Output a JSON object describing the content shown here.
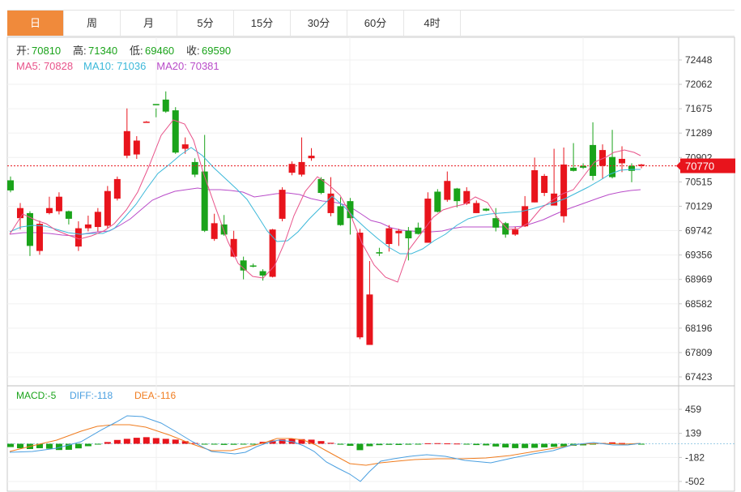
{
  "tabs": [
    {
      "label": "日",
      "active": true
    },
    {
      "label": "周",
      "active": false
    },
    {
      "label": "月",
      "active": false
    },
    {
      "label": "5分",
      "active": false
    },
    {
      "label": "15分",
      "active": false
    },
    {
      "label": "30分",
      "active": false
    },
    {
      "label": "60分",
      "active": false
    },
    {
      "label": "4时",
      "active": false
    }
  ],
  "ohlc_info": [
    {
      "label": "开:",
      "value": "70810"
    },
    {
      "label": "高:",
      "value": "71340"
    },
    {
      "label": "低:",
      "value": "69460"
    },
    {
      "label": "收:",
      "value": "69590"
    }
  ],
  "ma_info": [
    {
      "label": "MA5:",
      "value": "70828",
      "color": "#e8538a"
    },
    {
      "label": "MA10:",
      "value": "71036",
      "color": "#3bb8d9"
    },
    {
      "label": "MA20:",
      "value": "70381",
      "color": "#b94cc9"
    }
  ],
  "macd_info": [
    {
      "label": "MACD:",
      "value": "-5",
      "color": "#1aa31a"
    },
    {
      "label": "DIFF:",
      "value": "-118",
      "color": "#4a9fe0"
    },
    {
      "label": "DEA:",
      "value": "-116",
      "color": "#f07c1f"
    }
  ],
  "colors": {
    "up": "#e8141c",
    "down": "#1aa31a",
    "text": "#333333",
    "grid": "#f0f0f0",
    "axis": "#c8c8c8",
    "price_tag": "#e8141c"
  },
  "current_price": {
    "value": 70770,
    "label": "70770"
  },
  "chart_data": {
    "type": "candlestick",
    "price_axis": {
      "ticks": [
        72448,
        72062,
        71675,
        71289,
        70902,
        70515,
        70129,
        69742,
        69356,
        68969,
        68582,
        68196,
        67809,
        67423
      ]
    },
    "macd_axis": {
      "ticks": [
        459,
        139,
        -182,
        -502
      ]
    },
    "candles": [
      [
        70540,
        70380,
        70600,
        70350
      ],
      [
        69940,
        70100,
        70180,
        69760
      ],
      [
        70020,
        69500,
        70050,
        69340
      ],
      [
        69420,
        69850,
        69900,
        69360
      ],
      [
        70020,
        70100,
        70280,
        70000
      ],
      [
        70050,
        70280,
        70350,
        70000
      ],
      [
        70050,
        69930,
        70060,
        69840
      ],
      [
        69490,
        69780,
        69890,
        69420
      ],
      [
        69780,
        69840,
        69980,
        69730
      ],
      [
        69800,
        70040,
        70100,
        69730
      ],
      [
        69820,
        70370,
        70450,
        69780
      ],
      [
        70250,
        70560,
        70600,
        70220
      ],
      [
        70930,
        71320,
        71680,
        70890
      ],
      [
        70950,
        71170,
        71240,
        70880
      ],
      [
        71470,
        71470,
        71480,
        71470
      ],
      [
        71750,
        71730,
        71680,
        71540
      ],
      [
        71820,
        71630,
        71950,
        71610
      ],
      [
        71650,
        70980,
        71700,
        70960
      ],
      [
        71040,
        71110,
        71220,
        70960
      ],
      [
        70830,
        70630,
        70890,
        70590
      ],
      [
        70680,
        69740,
        71260,
        69720
      ],
      [
        69610,
        69860,
        70010,
        69580
      ],
      [
        69840,
        69680,
        69990,
        69660
      ],
      [
        69330,
        69610,
        69740,
        69320
      ],
      [
        69270,
        69110,
        69330,
        68970
      ],
      [
        69190,
        69180,
        69220,
        69160
      ],
      [
        69100,
        69030,
        69130,
        68950
      ],
      [
        69010,
        69760,
        69770,
        69000
      ],
      [
        69930,
        70390,
        70430,
        69890
      ],
      [
        70660,
        70800,
        70840,
        70620
      ],
      [
        70630,
        70830,
        71220,
        70600
      ],
      [
        70890,
        70930,
        71050,
        70850
      ],
      [
        70560,
        70340,
        70590,
        70320
      ],
      [
        70020,
        70330,
        70590,
        69970
      ],
      [
        70130,
        69830,
        70270,
        69820
      ],
      [
        70210,
        69940,
        70260,
        69680
      ],
      [
        68050,
        69710,
        69770,
        68020
      ],
      [
        67930,
        68730,
        69260,
        67940
      ],
      [
        69400,
        69380,
        69470,
        69340
      ],
      [
        69530,
        69780,
        69830,
        69410
      ],
      [
        69700,
        69740,
        69770,
        69500
      ],
      [
        69740,
        69620,
        69800,
        69270
      ],
      [
        69790,
        69690,
        69870,
        69680
      ],
      [
        69550,
        70250,
        70350,
        69550
      ],
      [
        70360,
        70040,
        70400,
        70030
      ],
      [
        70230,
        70530,
        70680,
        70200
      ],
      [
        70410,
        70210,
        70420,
        70110
      ],
      [
        70170,
        70370,
        70430,
        70150
      ],
      [
        70020,
        70180,
        70220,
        70020
      ],
      [
        70090,
        70060,
        70100,
        70050
      ],
      [
        69940,
        69790,
        70100,
        69730
      ],
      [
        69860,
        69680,
        69880,
        69630
      ],
      [
        69680,
        69760,
        69800,
        69660
      ],
      [
        69810,
        70130,
        70290,
        69800
      ],
      [
        70190,
        70700,
        70900,
        70190
      ],
      [
        70340,
        70610,
        70640,
        70290
      ],
      [
        70140,
        70330,
        71040,
        70150
      ],
      [
        69970,
        70790,
        71060,
        69870
      ],
      [
        70740,
        70690,
        71130,
        70680
      ],
      [
        70770,
        70740,
        70810,
        70720
      ],
      [
        71100,
        70610,
        71460,
        70540
      ],
      [
        70770,
        71020,
        71110,
        70560
      ],
      [
        70910,
        70590,
        71340,
        70570
      ],
      [
        70810,
        70880,
        71080,
        70670
      ],
      [
        70770,
        70690,
        70810,
        70510
      ],
      [
        70770,
        70790,
        70800,
        70730
      ]
    ],
    "ma5": [
      [
        12,
        289
      ],
      [
        28,
        264
      ],
      [
        45,
        272
      ],
      [
        57,
        276
      ],
      [
        69,
        284
      ],
      [
        84,
        290
      ],
      [
        98,
        295
      ],
      [
        113,
        291
      ],
      [
        128,
        285
      ],
      [
        141,
        276
      ],
      [
        156,
        259
      ],
      [
        170,
        237
      ],
      [
        184,
        205
      ],
      [
        199,
        167
      ],
      [
        214,
        148
      ],
      [
        228,
        153
      ],
      [
        239,
        173
      ],
      [
        251,
        213
      ],
      [
        265,
        253
      ],
      [
        281,
        297
      ],
      [
        294,
        325
      ],
      [
        312,
        341
      ],
      [
        325,
        343
      ],
      [
        339,
        328
      ],
      [
        352,
        298
      ],
      [
        363,
        266
      ],
      [
        377,
        236
      ],
      [
        392,
        218
      ],
      [
        407,
        229
      ],
      [
        420,
        241
      ],
      [
        432,
        263
      ],
      [
        447,
        300
      ],
      [
        462,
        327
      ],
      [
        476,
        342
      ],
      [
        491,
        348
      ],
      [
        505,
        308
      ],
      [
        520,
        288
      ],
      [
        535,
        268
      ],
      [
        547,
        259
      ],
      [
        560,
        255
      ],
      [
        573,
        252
      ],
      [
        587,
        243
      ],
      [
        602,
        250
      ],
      [
        615,
        270
      ],
      [
        627,
        283
      ],
      [
        640,
        282
      ],
      [
        653,
        275
      ],
      [
        668,
        257
      ],
      [
        682,
        247
      ],
      [
        695,
        239
      ],
      [
        708,
        234
      ],
      [
        721,
        217
      ],
      [
        734,
        200
      ],
      [
        748,
        194
      ],
      [
        758,
        188
      ],
      [
        771,
        185
      ],
      [
        783,
        188
      ],
      [
        791,
        192
      ]
    ],
    "ma10": [
      [
        12,
        286
      ],
      [
        26,
        280
      ],
      [
        41,
        278
      ],
      [
        56,
        279
      ],
      [
        70,
        283
      ],
      [
        84,
        287
      ],
      [
        99,
        289
      ],
      [
        113,
        288
      ],
      [
        127,
        288
      ],
      [
        141,
        282
      ],
      [
        154,
        268
      ],
      [
        168,
        252
      ],
      [
        181,
        233
      ],
      [
        195,
        214
      ],
      [
        209,
        203
      ],
      [
        223,
        191
      ],
      [
        236,
        182
      ],
      [
        250,
        192
      ],
      [
        264,
        207
      ],
      [
        278,
        220
      ],
      [
        292,
        233
      ],
      [
        305,
        246
      ],
      [
        318,
        266
      ],
      [
        330,
        285
      ],
      [
        342,
        298
      ],
      [
        355,
        297
      ],
      [
        368,
        286
      ],
      [
        382,
        270
      ],
      [
        397,
        255
      ],
      [
        410,
        242
      ],
      [
        424,
        254
      ],
      [
        438,
        269
      ],
      [
        452,
        282
      ],
      [
        466,
        294
      ],
      [
        480,
        305
      ],
      [
        494,
        313
      ],
      [
        508,
        313
      ],
      [
        522,
        307
      ],
      [
        536,
        297
      ],
      [
        550,
        289
      ],
      [
        564,
        278
      ],
      [
        578,
        270
      ],
      [
        592,
        266
      ],
      [
        605,
        264
      ],
      [
        617,
        263
      ],
      [
        630,
        262
      ],
      [
        643,
        261
      ],
      [
        656,
        258
      ],
      [
        670,
        254
      ],
      [
        684,
        250
      ],
      [
        698,
        245
      ],
      [
        712,
        238
      ],
      [
        726,
        231
      ],
      [
        740,
        223
      ],
      [
        753,
        215
      ],
      [
        766,
        210
      ],
      [
        780,
        209
      ],
      [
        791,
        209
      ]
    ],
    "ma20": [
      [
        12,
        289
      ],
      [
        29,
        287
      ],
      [
        45,
        287
      ],
      [
        61,
        288
      ],
      [
        77,
        290
      ],
      [
        92,
        291
      ],
      [
        107,
        288
      ],
      [
        121,
        286
      ],
      [
        135,
        285
      ],
      [
        148,
        278
      ],
      [
        161,
        270
      ],
      [
        175,
        258
      ],
      [
        188,
        247
      ],
      [
        202,
        241
      ],
      [
        216,
        236
      ],
      [
        230,
        234
      ],
      [
        244,
        232
      ],
      [
        258,
        234
      ],
      [
        272,
        234
      ],
      [
        285,
        235
      ],
      [
        300,
        237
      ],
      [
        314,
        243
      ],
      [
        328,
        241
      ],
      [
        341,
        239
      ],
      [
        355,
        238
      ],
      [
        370,
        240
      ],
      [
        384,
        245
      ],
      [
        398,
        248
      ],
      [
        410,
        249
      ],
      [
        420,
        251
      ],
      [
        432,
        255
      ],
      [
        446,
        264
      ],
      [
        458,
        272
      ],
      [
        470,
        275
      ],
      [
        483,
        281
      ],
      [
        496,
        284
      ],
      [
        508,
        285
      ],
      [
        521,
        286
      ],
      [
        533,
        286
      ],
      [
        546,
        285
      ],
      [
        558,
        282
      ],
      [
        571,
        280
      ],
      [
        584,
        280
      ],
      [
        596,
        280
      ],
      [
        608,
        280
      ],
      [
        620,
        280
      ],
      [
        633,
        280
      ],
      [
        646,
        279
      ],
      [
        659,
        275
      ],
      [
        671,
        271
      ],
      [
        684,
        265
      ],
      [
        698,
        259
      ],
      [
        712,
        254
      ],
      [
        726,
        249
      ],
      [
        740,
        244
      ],
      [
        752,
        240
      ],
      [
        766,
        237
      ],
      [
        779,
        235
      ],
      [
        791,
        234
      ]
    ],
    "macd_hist": [
      -44,
      -60,
      -70,
      -59,
      -66,
      -83,
      -80,
      -61,
      -32,
      -9,
      23,
      51,
      66,
      80,
      88,
      76,
      66,
      56,
      35,
      11,
      -1,
      -4,
      -15,
      -13,
      -10,
      -2,
      26,
      44,
      58,
      66,
      62,
      55,
      36,
      13,
      -12,
      -27,
      -85,
      -32,
      -18,
      -14,
      -16,
      -12,
      -6,
      7,
      8,
      5,
      3,
      -9,
      -17,
      -21,
      -36,
      -49,
      -58,
      -57,
      -54,
      -48,
      -41,
      -34,
      -26,
      -21,
      -3,
      11,
      19,
      10,
      -8,
      -2
    ],
    "diff_line": [
      [
        12,
        558
      ],
      [
        40,
        557
      ],
      [
        70,
        553
      ],
      [
        100,
        545
      ],
      [
        126,
        530
      ],
      [
        143,
        521
      ],
      [
        157,
        513
      ],
      [
        176,
        514
      ],
      [
        199,
        522
      ],
      [
        218,
        533
      ],
      [
        236,
        544
      ],
      [
        261,
        557
      ],
      [
        290,
        560
      ],
      [
        303,
        558
      ],
      [
        317,
        551
      ],
      [
        331,
        546
      ],
      [
        344,
        543
      ],
      [
        362,
        545
      ],
      [
        375,
        550
      ],
      [
        388,
        557
      ],
      [
        403,
        570
      ],
      [
        418,
        578
      ],
      [
        432,
        585
      ],
      [
        445,
        594
      ],
      [
        456,
        582
      ],
      [
        470,
        569
      ],
      [
        486,
        566
      ],
      [
        506,
        563
      ],
      [
        527,
        561
      ],
      [
        550,
        563
      ],
      [
        574,
        568
      ],
      [
        606,
        571
      ],
      [
        633,
        565
      ],
      [
        658,
        560
      ],
      [
        683,
        556
      ],
      [
        706,
        549
      ],
      [
        733,
        546
      ],
      [
        757,
        549
      ],
      [
        775,
        549
      ],
      [
        791,
        547
      ]
    ],
    "dea_line": [
      [
        12,
        557
      ],
      [
        40,
        550
      ],
      [
        70,
        543
      ],
      [
        100,
        532
      ],
      [
        120,
        526
      ],
      [
        140,
        524
      ],
      [
        160,
        524
      ],
      [
        180,
        527
      ],
      [
        210,
        537
      ],
      [
        235,
        547
      ],
      [
        261,
        556
      ],
      [
        285,
        556
      ],
      [
        307,
        551
      ],
      [
        327,
        546
      ],
      [
        342,
        541
      ],
      [
        360,
        541
      ],
      [
        375,
        543
      ],
      [
        390,
        549
      ],
      [
        410,
        560
      ],
      [
        432,
        572
      ],
      [
        452,
        574
      ],
      [
        470,
        571
      ],
      [
        490,
        569
      ],
      [
        512,
        567
      ],
      [
        540,
        566
      ],
      [
        570,
        566
      ],
      [
        600,
        565
      ],
      [
        630,
        562
      ],
      [
        660,
        557
      ],
      [
        690,
        552
      ],
      [
        715,
        548
      ],
      [
        742,
        547
      ],
      [
        770,
        548
      ],
      [
        791,
        547
      ]
    ]
  }
}
